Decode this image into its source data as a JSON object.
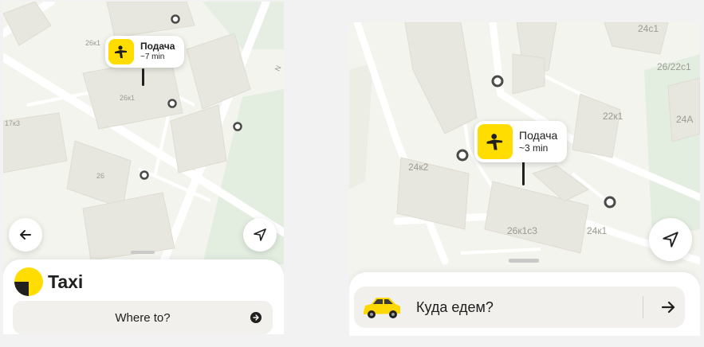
{
  "screen_a": {
    "pickup": {
      "title": "Подача",
      "time": "~7 min"
    },
    "buildings": [
      "26к1",
      "26к1",
      "17к3",
      "26"
    ],
    "street": "N",
    "brand": "Taxi",
    "destination_placeholder": "Where to?",
    "icons": [
      "back-arrow-icon",
      "locate-arrow-icon",
      "yandex-taxi-logo-icon",
      "go-arrow-icon",
      "pointing-person-icon"
    ]
  },
  "screen_b": {
    "pickup": {
      "title": "Подача",
      "time": "~3 min"
    },
    "buildings": [
      "24с1",
      "26/22с1",
      "22к1",
      "24A",
      "24к2",
      "26к1с3",
      "24к1"
    ],
    "destination_placeholder": "Куда едем?",
    "icons": [
      "locate-arrow-icon",
      "yellow-taxi-car-icon",
      "forward-arrow-icon",
      "pointing-person-icon"
    ]
  },
  "colors": {
    "accent": "#ffdd00",
    "dark": "#21201f",
    "map_bg": "#f4f4ef",
    "building": "#e8e7df",
    "park": "#e3ede0",
    "field": "#f1f0ed"
  }
}
